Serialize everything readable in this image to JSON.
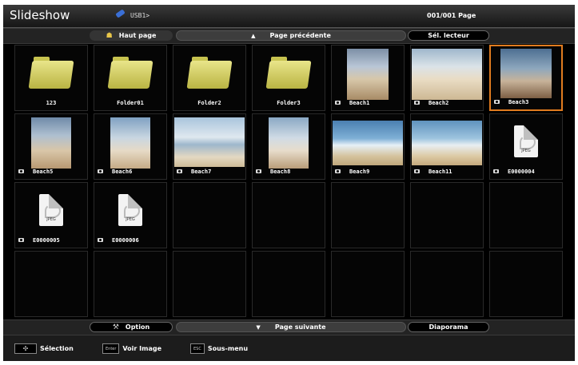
{
  "header": {
    "title": "Slideshow",
    "path": "USB1>",
    "page_counter": "001/001 Page",
    "usb_color": "#3a6fd6"
  },
  "nav_top": {
    "top_page": "Haut page",
    "top_page_icon": "home-icon",
    "prev_page": "Page précédente",
    "select_reader": "Sél. lecteur"
  },
  "nav_bottom": {
    "option": "Option",
    "option_icon": "wrench-icon",
    "next_page": "Page suivante",
    "slideshow": "Diaporama"
  },
  "footer": {
    "select_key": "move-arrows-icon",
    "select_label": "Sélection",
    "enter_key": "Enter",
    "view_label": "Voir Image",
    "esc_key": "ESC",
    "submenu_label": "Sous-menu"
  },
  "grid": {
    "items": [
      {
        "label": "123",
        "type": "folder"
      },
      {
        "label": "Folder01",
        "type": "folder"
      },
      {
        "label": "Folder2",
        "type": "folder"
      },
      {
        "label": "Folder3",
        "type": "folder"
      },
      {
        "label": "Beach1",
        "type": "image"
      },
      {
        "label": "Beach2",
        "type": "image"
      },
      {
        "label": "Beach3",
        "type": "image",
        "selected": true
      },
      {
        "label": "Beach5",
        "type": "image"
      },
      {
        "label": "Beach6",
        "type": "image"
      },
      {
        "label": "Beach7",
        "type": "image"
      },
      {
        "label": "Beach8",
        "type": "image"
      },
      {
        "label": "Beach9",
        "type": "image"
      },
      {
        "label": "Beach11",
        "type": "image"
      },
      {
        "label": "E0000004",
        "type": "jpeg"
      },
      {
        "label": "E0000005",
        "type": "jpeg"
      },
      {
        "label": "E0000006",
        "type": "jpeg"
      }
    ],
    "jpeg_text": "JPEG",
    "selection_color": "#e07b1f"
  }
}
